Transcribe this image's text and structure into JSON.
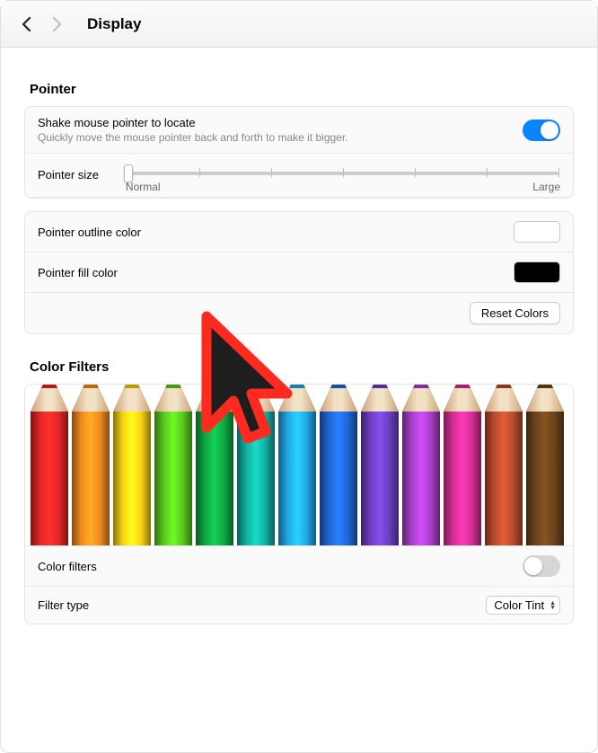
{
  "header": {
    "title": "Display"
  },
  "pointer": {
    "section_title": "Pointer",
    "shake_label": "Shake mouse pointer to locate",
    "shake_sub": "Quickly move the mouse pointer back and forth to make it bigger.",
    "shake_on": true,
    "size_label": "Pointer size",
    "size_value": 0,
    "size_min_label": "Normal",
    "size_max_label": "Large",
    "outline_label": "Pointer outline color",
    "outline_color": "#ffffff",
    "fill_label": "Pointer fill color",
    "fill_color": "#000000",
    "reset_label": "Reset Colors"
  },
  "cursor_preview": {
    "outline_color": "#ff2a1f",
    "fill_color": "#1e1e1e"
  },
  "filters": {
    "section_title": "Color Filters",
    "pencil_colors": [
      "#e22525",
      "#f08a1f",
      "#f5d014",
      "#59c91e",
      "#0fa843",
      "#11b0a0",
      "#21a7e6",
      "#1f66d4",
      "#6b3fc0",
      "#a83fc7",
      "#d42f93",
      "#b84a2c",
      "#6a431a"
    ],
    "toggle_label": "Color filters",
    "toggle_on": false,
    "type_label": "Filter type",
    "type_value": "Color Tint"
  }
}
